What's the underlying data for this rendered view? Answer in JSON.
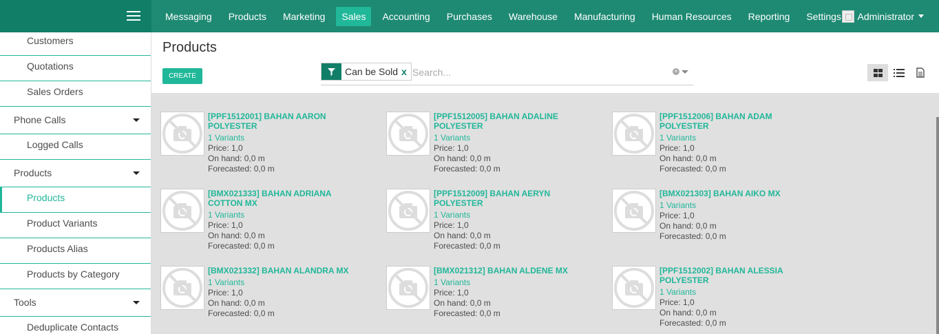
{
  "topbar": {
    "menu": [
      "Messaging",
      "Products",
      "Marketing",
      "Sales",
      "Accounting",
      "Purchases",
      "Warehouse",
      "Manufacturing",
      "Human Resources",
      "Reporting",
      "Settings"
    ],
    "active": "Sales",
    "user": "Administrator"
  },
  "sidebar": {
    "items": [
      {
        "type": "sub",
        "label": "Customers"
      },
      {
        "type": "sub",
        "label": "Quotations"
      },
      {
        "type": "sub",
        "label": "Sales Orders"
      },
      {
        "type": "head",
        "label": "Phone Calls"
      },
      {
        "type": "sub",
        "label": "Logged Calls"
      },
      {
        "type": "head",
        "label": "Products"
      },
      {
        "type": "sub",
        "label": "Products",
        "active": true
      },
      {
        "type": "sub",
        "label": "Product Variants"
      },
      {
        "type": "sub",
        "label": "Products Alias"
      },
      {
        "type": "sub",
        "label": "Products by Category"
      },
      {
        "type": "head",
        "label": "Tools"
      },
      {
        "type": "sub",
        "label": "Deduplicate Contacts"
      }
    ]
  },
  "control": {
    "title": "Products",
    "create_label": "CREATE",
    "facet_label": "Can be Sold",
    "facet_remove": "x",
    "search_placeholder": "Search..."
  },
  "products": [
    {
      "name": "[PPF1512001] BAHAN AARON POLYESTER",
      "variants": "1 Variants",
      "price": "Price: 1,0",
      "onhand": "On hand: 0,0 m",
      "forecast": "Forecasted: 0,0 m"
    },
    {
      "name": "[PPF1512005] BAHAN ADALINE POLYESTER",
      "variants": "1 Variants",
      "price": "Price: 1,0",
      "onhand": "On hand: 0,0 m",
      "forecast": "Forecasted: 0,0 m"
    },
    {
      "name": "[PPF1512006] BAHAN ADAM POLYESTER",
      "variants": "1 Variants",
      "price": "Price: 1,0",
      "onhand": "On hand: 0,0 m",
      "forecast": "Forecasted: 0,0 m"
    },
    {
      "name": "[BMX021333] BAHAN ADRIANA COTTON MX",
      "variants": "1 Variants",
      "price": "Price: 1,0",
      "onhand": "On hand: 0,0 m",
      "forecast": "Forecasted: 0,0 m"
    },
    {
      "name": "[PPF1512009] BAHAN AERYN POLYESTER",
      "variants": "1 Variants",
      "price": "Price: 1,0",
      "onhand": "On hand: 0,0 m",
      "forecast": "Forecasted: 0,0 m"
    },
    {
      "name": "[BMX021303] BAHAN AIKO MX",
      "variants": "1 Variants",
      "price": "Price: 1,0",
      "onhand": "On hand: 0,0 m",
      "forecast": "Forecasted: 0,0 m"
    },
    {
      "name": "[BMX021332] BAHAN ALANDRA MX",
      "variants": "1 Variants",
      "price": "Price: 1,0",
      "onhand": "On hand: 0,0 m",
      "forecast": "Forecasted: 0,0 m"
    },
    {
      "name": "[BMX021312] BAHAN ALDENE MX",
      "variants": "1 Variants",
      "price": "Price: 1,0",
      "onhand": "On hand: 0,0 m",
      "forecast": "Forecasted: 0,0 m"
    },
    {
      "name": "[PPF1512002] BAHAN ALESSIA POLYESTER",
      "variants": "1 Variants",
      "price": "Price: 1,0",
      "onhand": "On hand: 0,0 m",
      "forecast": "Forecasted: 0,0 m"
    }
  ]
}
